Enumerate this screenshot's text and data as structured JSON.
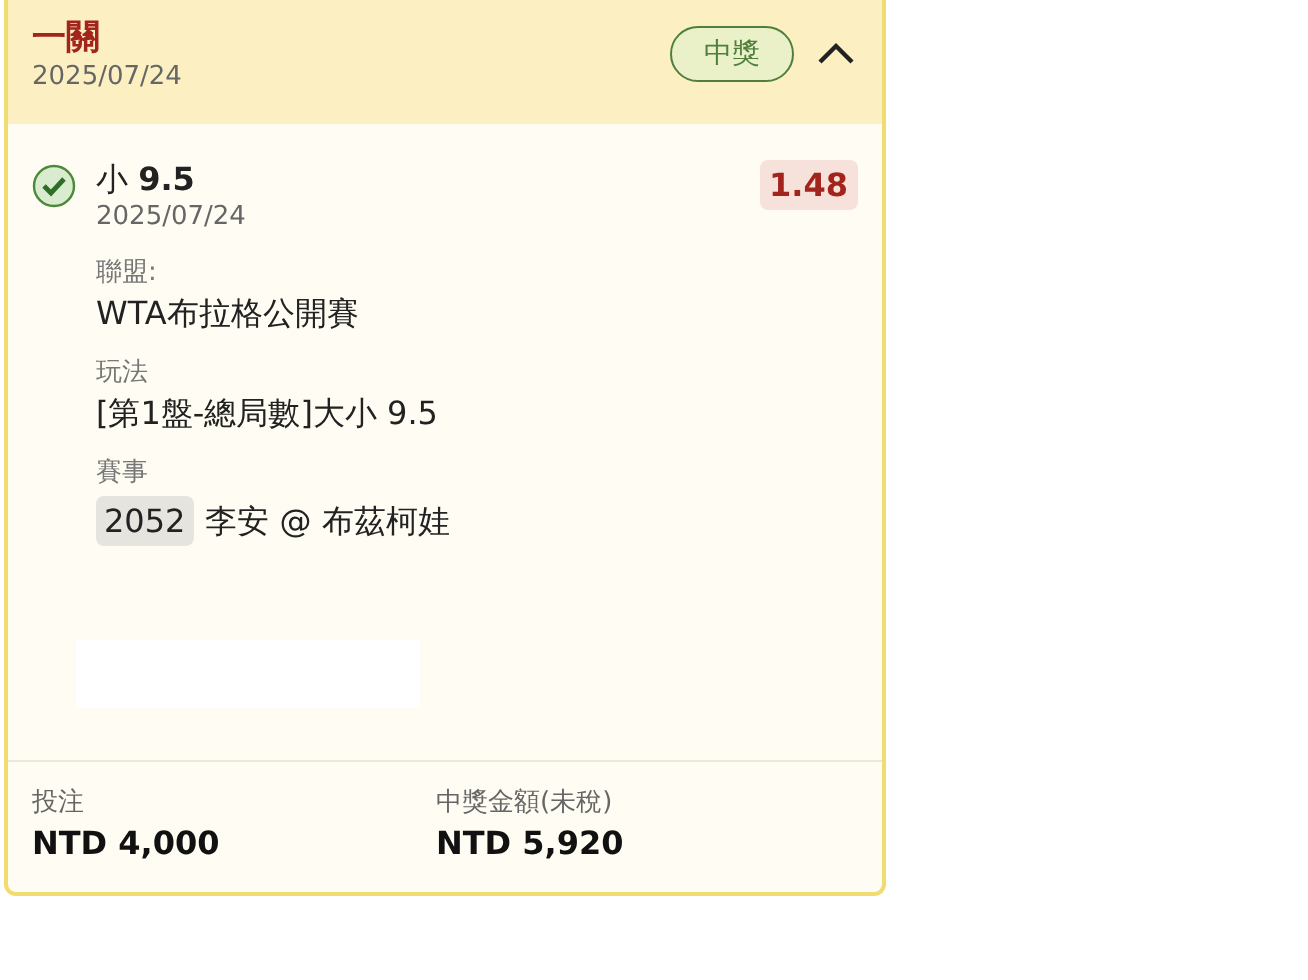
{
  "header": {
    "title": "一關",
    "date": "2025/07/24",
    "status": {
      "label": "中獎",
      "kind": "won"
    },
    "expanded": true
  },
  "selection": {
    "checked": true,
    "pick": "小 **9.5**",
    "date": "2025/07/24",
    "odds": "1.48",
    "fields": [
      {
        "label": "聯盟:",
        "value": "WTA布拉格公開賽"
      },
      {
        "label": "玩法",
        "value": "[第1盤-總局數]大小 9.5"
      }
    ],
    "event": {
      "label": "賽事",
      "code": "2052",
      "name": "李安 @ 布茲柯娃"
    }
  },
  "footer": [
    {
      "label": "投注",
      "value": "NTD 4,000"
    },
    {
      "label": "中獎金額(未稅)",
      "value": "NTD 5,920"
    }
  ]
}
